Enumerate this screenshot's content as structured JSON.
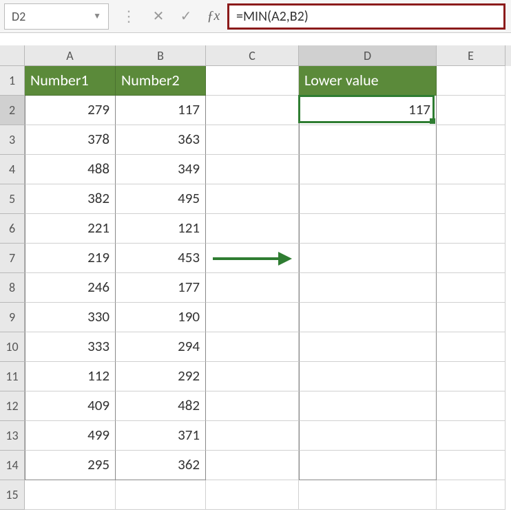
{
  "formulaBar": {
    "cellRef": "D2",
    "formula": "=MIN(A2,B2)"
  },
  "columns": [
    {
      "letter": "A",
      "class": "col-A"
    },
    {
      "letter": "B",
      "class": "col-B"
    },
    {
      "letter": "C",
      "class": "col-C"
    },
    {
      "letter": "D",
      "class": "col-D",
      "selected": true
    },
    {
      "letter": "E",
      "class": "col-E"
    }
  ],
  "headers": {
    "A": "Number1",
    "B": "Number2",
    "D": "Lower value"
  },
  "colors": {
    "headerBg": "#5B8A3A",
    "selectionBorder": "#2F7D32",
    "formulaHighlight": "#8B1A1A"
  },
  "selectedCell": "D2",
  "selectedValue": "117",
  "rows": [
    {
      "n": 2,
      "A": "279",
      "B": "117",
      "D": "117",
      "selected": true
    },
    {
      "n": 3,
      "A": "378",
      "B": "363"
    },
    {
      "n": 4,
      "A": "488",
      "B": "349"
    },
    {
      "n": 5,
      "A": "382",
      "B": "495"
    },
    {
      "n": 6,
      "A": "221",
      "B": "121"
    },
    {
      "n": 7,
      "A": "219",
      "B": "453"
    },
    {
      "n": 8,
      "A": "246",
      "B": "177"
    },
    {
      "n": 9,
      "A": "330",
      "B": "190"
    },
    {
      "n": 10,
      "A": "333",
      "B": "294"
    },
    {
      "n": 11,
      "A": "112",
      "B": "292"
    },
    {
      "n": 12,
      "A": "409",
      "B": "482"
    },
    {
      "n": 13,
      "A": "499",
      "B": "371"
    },
    {
      "n": 14,
      "A": "295",
      "B": "362"
    }
  ],
  "emptyRows": [
    15
  ],
  "arrowRow": 7
}
